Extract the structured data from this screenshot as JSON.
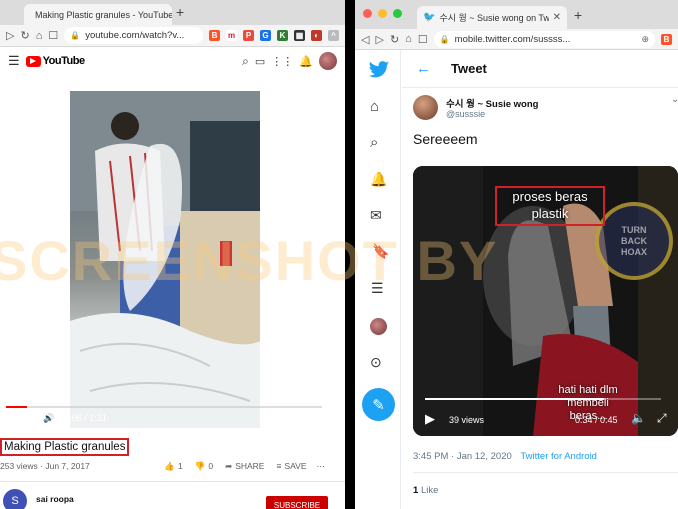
{
  "left_window": {
    "tab_title": "Making Plastic granules - YouTube",
    "url": "youtube.com/watch?v...",
    "youtube_logo": "YouTube",
    "video": {
      "time": "0:06 / 1:31",
      "progress": 0.066
    },
    "title": "Making Plastic granules",
    "meta": "253 views · Jun 7, 2017",
    "likes": "1",
    "dislikes": "0",
    "share_label": "SHARE",
    "save_label": "SAVE",
    "channel": "sai roopa",
    "subscribe_label": "SUBSCRIBE",
    "channel_initial": "S"
  },
  "right_window": {
    "tab_title": "수시 웡 ~ Susie wong on Twitter: \"S",
    "url": "mobile.twitter.com/sussss...",
    "header_title": "Tweet",
    "author_name": "수시 웡 ~ Susie wong",
    "author_handle": "@susssie",
    "tweet_text": "Sereeeem",
    "video": {
      "overlay_top": "proses beras\nplastik",
      "overlay_bottom": "hati hati dlm\nmembeli\nberas...",
      "views": "39 views",
      "time": "0:34 / 0:45",
      "progress": 0.76
    },
    "timestamp": "3:45 PM · Jan 12, 2020",
    "source": "Twitter for Android",
    "like_count": "1",
    "like_label": "Like",
    "badge_text": "TURN BACK HOAX"
  },
  "watermark_text": "SCREENSHOT BY",
  "colors": {
    "youtube_red": "#ff0000",
    "twitter_blue": "#1da1f2",
    "highlight_red": "#d0202a",
    "subscribe_red": "#cc0000"
  }
}
